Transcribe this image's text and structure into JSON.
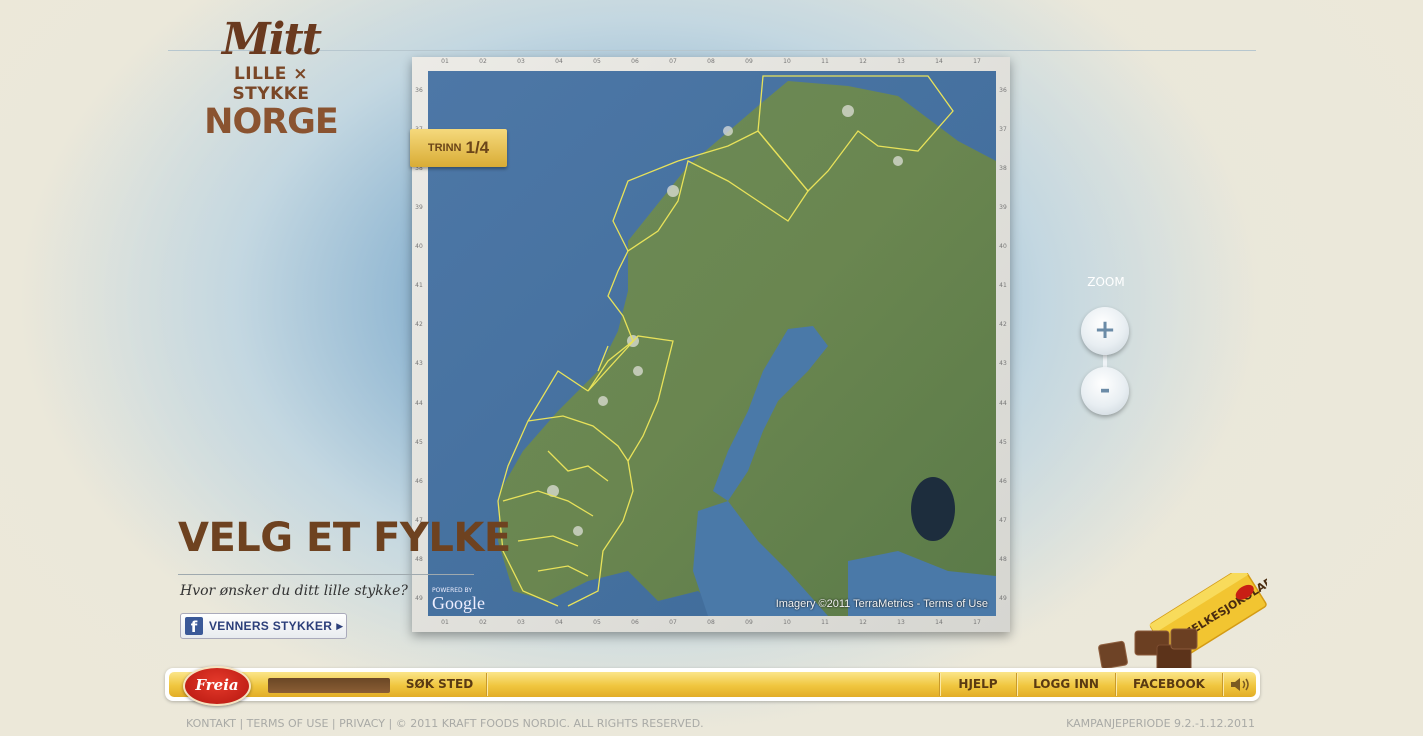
{
  "logo": {
    "line1": "Mitt",
    "line2": "LILLE × STYKKE",
    "line3": "NORGE"
  },
  "map": {
    "step_label": "TRINN",
    "step_value": "1/4",
    "powered_by": "POWERED BY",
    "google": "Google",
    "imagery": "Imagery ©2011 TerraMetrics - Terms of Use",
    "ticks_h": [
      "01",
      "02",
      "03",
      "04",
      "05",
      "06",
      "07",
      "08",
      "09",
      "10",
      "11",
      "12",
      "13",
      "14",
      "17"
    ],
    "ticks_v": [
      "36",
      "37",
      "38",
      "39",
      "40",
      "41",
      "42",
      "43",
      "44",
      "45",
      "46",
      "47",
      "48",
      "49"
    ]
  },
  "zoom": {
    "label": "ZOOM",
    "in": "+",
    "out": "-"
  },
  "main": {
    "headline": "VELG ET FYLKE",
    "subtitle": "Hvor ønsker du ditt lille stykke?",
    "friends_button": "VENNERS STYKKER",
    "fb_glyph": "f"
  },
  "product": {
    "name": "MELKESJOKOLADE",
    "brand": "Freia"
  },
  "bar": {
    "brand": "Freia",
    "search": "SØK STED",
    "help": "HJELP",
    "login": "LOGG INN",
    "facebook": "FACEBOOK"
  },
  "footer": {
    "kontakt": "KONTAKT",
    "terms": "TERMS OF USE",
    "privacy": "PRIVACY",
    "copyright": "© 2011 KRAFT FOODS NORDIC. ALL RIGHTS RESERVED.",
    "period": "KAMPANJEPERIODE 9.2.-1.12.2011"
  },
  "colors": {
    "brand_brown": "#6e4220",
    "bar_yellow": "#f0c63f",
    "freia_red": "#c81e14",
    "border_yellow": "#e8e25a"
  }
}
